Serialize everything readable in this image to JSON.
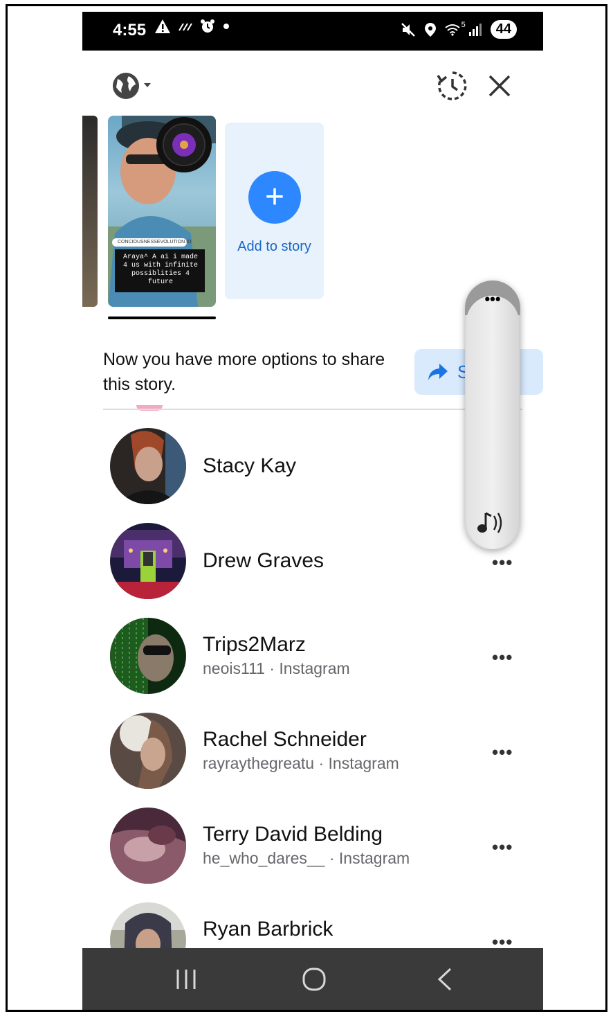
{
  "status_bar": {
    "time": "4:55",
    "left_icons": [
      "warning-icon",
      "wifi-calling-icon",
      "alarm-icon",
      "dot-icon"
    ],
    "right_icons": [
      "mute-icon",
      "location-icon",
      "wifi-icon",
      "signal-icon"
    ],
    "wifi_label": "5",
    "battery": "44"
  },
  "header": {
    "audience_icon": "globe-icon",
    "history_icon": "history-icon",
    "close_icon": "close-icon"
  },
  "stories": {
    "thumb_tag": "CONCIOUSNESSEVOLUTION.IO",
    "thumb_text": "Araya^ A ai i made 4 us with infinite possiblities 4 future",
    "add_story_label": "Add to story"
  },
  "share_prompt": {
    "text": "Now you have more options to share this story.",
    "button_label": "S"
  },
  "contacts": [
    {
      "name": "Stacy Kay",
      "sub": ""
    },
    {
      "name": "Drew Graves",
      "sub": ""
    },
    {
      "name": "Trips2Marz",
      "sub": "neois111 · Instagram"
    },
    {
      "name": "Rachel Schneider",
      "sub": "rayraythegreatu · Instagram"
    },
    {
      "name": "Terry David Belding",
      "sub": "he_who_dares__ · Instagram"
    },
    {
      "name": "Ryan Barbrick",
      "sub": ""
    }
  ],
  "more_label": "•••",
  "floating_panel": {
    "dots": "•••",
    "sound_icon": "sound-icon"
  },
  "nav": [
    "recents-icon",
    "home-icon",
    "back-icon"
  ]
}
